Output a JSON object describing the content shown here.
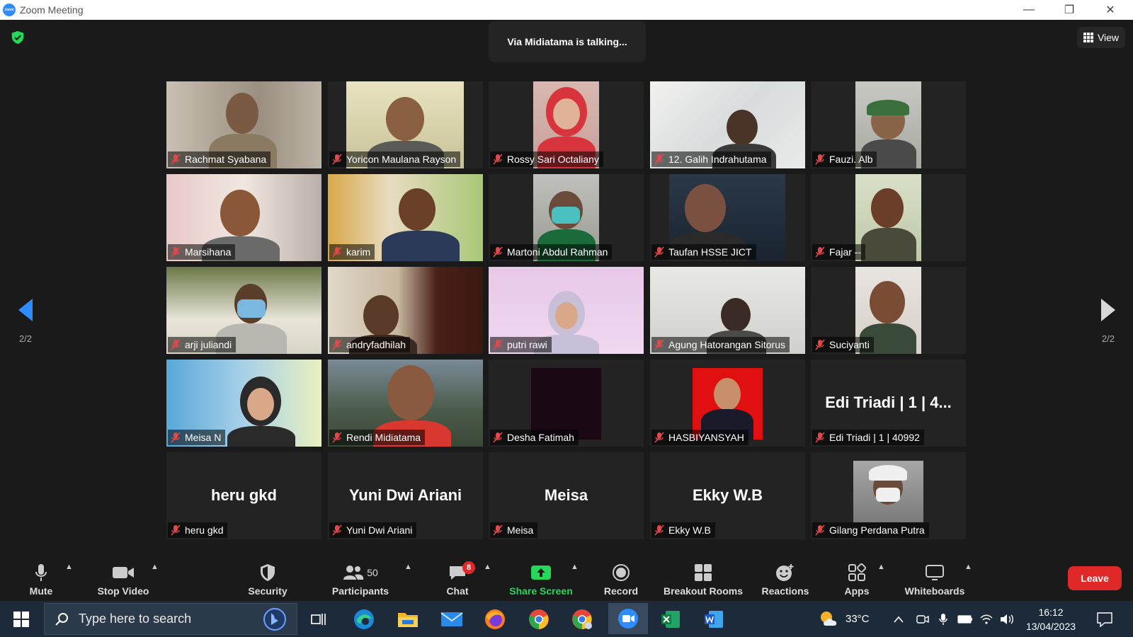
{
  "window": {
    "title": "Zoom Meeting",
    "app_icon": "zoom",
    "logo_text": "zoom"
  },
  "meeting": {
    "talking_banner": "Via Midiatama is talking...",
    "view_label": "View",
    "page_indicator_left": "2/2",
    "page_indicator_right": "2/2"
  },
  "tiles": [
    {
      "name": "Rachmat Syabana",
      "video": true
    },
    {
      "name": "Yoricon Maulana Rayson",
      "video": true
    },
    {
      "name": "Rossy Sari Octaliany",
      "video": true
    },
    {
      "name": "12. Galih Indrahutama",
      "video": true
    },
    {
      "name": "Fauzi. Alb",
      "video": true
    },
    {
      "name": "Marsihana",
      "video": true
    },
    {
      "name": "karim",
      "video": true
    },
    {
      "name": "Martoni Abdul Rahman",
      "video": true
    },
    {
      "name": "Taufan HSSE JICT",
      "video": true
    },
    {
      "name": "Fajar --",
      "video": true
    },
    {
      "name": "arji juliandi",
      "video": true
    },
    {
      "name": "andryfadhilah",
      "video": true
    },
    {
      "name": "putri rawi",
      "video": true
    },
    {
      "name": "Agung Hatorangan Sitorus",
      "video": true
    },
    {
      "name": "Suciyanti",
      "video": true
    },
    {
      "name": "Meisa N",
      "video": true
    },
    {
      "name": "Rendi Midiatama",
      "video": true
    },
    {
      "name": "Desha Fatimah",
      "video": true
    },
    {
      "name": "HASBIYANSYAH",
      "video": true
    },
    {
      "name": "Edi Triadi | 1 | 40992",
      "video": false,
      "big_label": "Edi Triadi | 1 | 4..."
    },
    {
      "name": "heru gkd",
      "video": false,
      "big_label": "heru gkd"
    },
    {
      "name": "Yuni Dwi Ariani",
      "video": false,
      "big_label": "Yuni Dwi Ariani"
    },
    {
      "name": "Meisa",
      "video": false,
      "big_label": "Meisa"
    },
    {
      "name": "Ekky W.B",
      "video": false,
      "big_label": "Ekky W.B"
    },
    {
      "name": "Gilang Perdana Putra",
      "video": true
    }
  ],
  "toolbar": {
    "mute": "Mute",
    "stop_video": "Stop Video",
    "security": "Security",
    "participants": "Participants",
    "participants_count": "50",
    "chat": "Chat",
    "chat_badge": "8",
    "share_screen": "Share Screen",
    "record": "Record",
    "breakout_rooms": "Breakout Rooms",
    "reactions": "Reactions",
    "apps": "Apps",
    "whiteboards": "Whiteboards",
    "leave": "Leave"
  },
  "taskbar": {
    "search_placeholder": "Type here to search",
    "weather": "33°C",
    "time": "16:12",
    "date": "13/04/2023",
    "apps": [
      "task-view",
      "edge",
      "file-explorer",
      "mail",
      "firefox",
      "chrome",
      "chrome-profile",
      "zoom",
      "excel",
      "word"
    ]
  },
  "colors": {
    "accent_blue": "#2d8cff",
    "share_green": "#23d959",
    "leave_red": "#e02828",
    "mic_off_red": "#e0484b",
    "taskbar_bg": "#1c2a3a"
  }
}
